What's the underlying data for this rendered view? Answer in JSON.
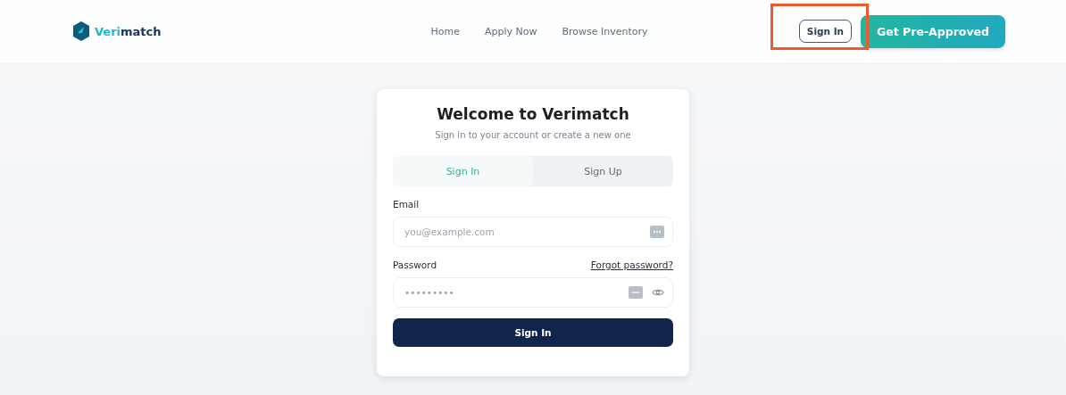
{
  "header": {
    "brand": {
      "first": "Veri",
      "rest": "match"
    },
    "nav": [
      {
        "label": "Home"
      },
      {
        "label": "Apply Now"
      },
      {
        "label": "Browse Inventory"
      }
    ],
    "sign_in_button": {
      "label": "Sign In",
      "highlighted": true
    },
    "cta_button": {
      "label": "Get Pre-Approved"
    }
  },
  "card": {
    "title": "Welcome to Verimatch",
    "subtitle": "Sign in to your account or create a new one",
    "tabs": [
      {
        "label": "Sign In",
        "selected": true
      },
      {
        "label": "Sign Up",
        "selected": false
      }
    ],
    "email": {
      "label": "Email",
      "placeholder": "you@example.com"
    },
    "password": {
      "label": "Password",
      "forgot_link": "Forgot password?",
      "placeholder": "•••••••••"
    },
    "submit_button": {
      "label": "Sign In"
    }
  }
}
